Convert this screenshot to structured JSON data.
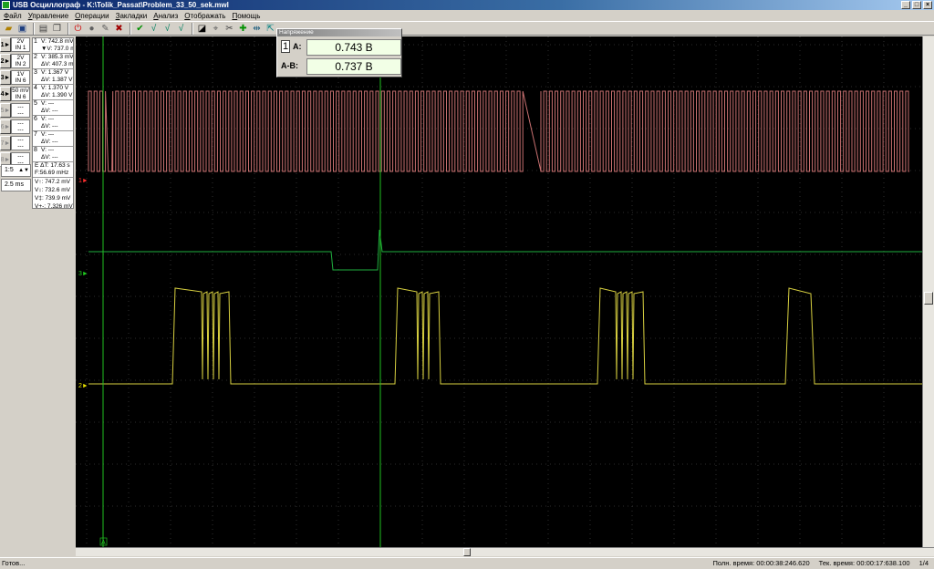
{
  "window": {
    "title": "USB Осциллограф - K:\\Tolik_Passat\\Problem_33_50_sek.mwl"
  },
  "menu": [
    "Файл",
    "Управление",
    "Операции",
    "Закладки",
    "Анализ",
    "Отображать",
    "Помощь"
  ],
  "toolbar_icons": [
    "open-icon",
    "save-icon",
    "print-icon",
    "copy-icon",
    "stop-icon",
    "record-icon",
    "probe-icon",
    "delete-icon",
    "check-icon",
    "check-a-icon",
    "check-b-icon",
    "check-c-icon",
    "contrast-icon",
    "cursor-icon",
    "scissors-icon",
    "arrow-icon",
    "marker-icon",
    "zoom-icon"
  ],
  "channels": [
    {
      "num": "1",
      "scale": "2V",
      "input": "IN 1"
    },
    {
      "num": "2",
      "scale": "2V",
      "input": "IN 2"
    },
    {
      "num": "3",
      "scale": "1V",
      "input": "IN 6"
    },
    {
      "num": "4",
      "scale": "50 mV",
      "input": "IN 6"
    },
    {
      "num": "5",
      "scale": "---",
      "input": "---"
    },
    {
      "num": "6",
      "scale": "---",
      "input": "---"
    },
    {
      "num": "7",
      "scale": "---",
      "input": "---"
    },
    {
      "num": "8",
      "scale": "---",
      "input": "---"
    }
  ],
  "measurements": [
    {
      "num": "1",
      "v": "V: 742.8 mV",
      "dv": "▼V: 737.0 mV"
    },
    {
      "num": "2",
      "v": "V: 385.3 mV",
      "dv": "ΔV: 407.3 mV"
    },
    {
      "num": "3",
      "v": "V: 1.367 V",
      "dv": "ΔV: 1.387 V"
    },
    {
      "num": "4",
      "v": "V: 1.370 V",
      "dv": "ΔV: 1.390 V"
    },
    {
      "num": "5",
      "v": "V: ---",
      "dv": "ΔV: ---"
    },
    {
      "num": "6",
      "v": "V: ---",
      "dv": "ΔV: ---"
    },
    {
      "num": "7",
      "v": "V: ---",
      "dv": "ΔV: ---"
    },
    {
      "num": "8",
      "v": "V: ---",
      "dv": "ΔV: ---"
    }
  ],
  "time_measure": {
    "dt": "E ΔT: 17.63 s",
    "f": "F:56.69 mHz"
  },
  "volt_summary": [
    "V↑: 747.2 mV",
    "V↕: 732.6 mV",
    "V‡: 739.9 mV",
    "V+-: 7.326 mV"
  ],
  "zoom": "1:5",
  "timebase": "2.5 ms",
  "readout": {
    "title": "Напряжение",
    "channel": "1",
    "a_label": "A:",
    "a_value": "0.743 В",
    "ab_label": "A-B:",
    "ab_value": "0.737 В"
  },
  "trace_labels": [
    {
      "text": "1►",
      "color": "#ff3030"
    },
    {
      "text": "3►",
      "color": "#20d020"
    },
    {
      "text": "2►",
      "color": "#e8e000"
    }
  ],
  "cursor_label": "A",
  "status": {
    "left": "Готов...",
    "full_time": "Полн. время: 00:00:38:246.620",
    "cur_time": "Тек. время: 00:00:17:638.100",
    "page": "1/4"
  },
  "colors": {
    "ch1": "#c87070",
    "ch2": "#d8d040",
    "ch3": "#20b040",
    "cursor": "#20c020",
    "grid": "#3a3a3a"
  }
}
